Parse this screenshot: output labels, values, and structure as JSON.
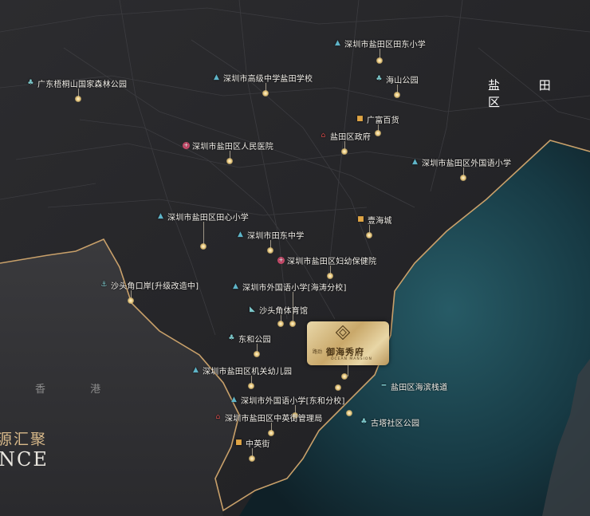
{
  "map": {
    "regions": {
      "yantian": "盐 田 区",
      "hongkong": "香 港"
    },
    "slogan": {
      "cn": "源汇聚",
      "en": "NCE"
    },
    "project": {
      "developer": "路劲",
      "name": "御海秀府",
      "name_en": "OCEAN MANSION"
    },
    "pois": [
      {
        "name": "深圳市盐田区田东小学",
        "icon": "school-icon"
      },
      {
        "name": "广东梧桐山国家森林公园",
        "icon": "park-icon"
      },
      {
        "name": "深圳市高级中学盐田学校",
        "icon": "school-icon"
      },
      {
        "name": "海山公园",
        "icon": "park-icon"
      },
      {
        "name": "广富百货",
        "icon": "shop-icon"
      },
      {
        "name": "盐田区政府",
        "icon": "government-icon"
      },
      {
        "name": "深圳市盐田区人民医院",
        "icon": "hospital-icon"
      },
      {
        "name": "深圳市盐田区外国语小学",
        "icon": "school-icon"
      },
      {
        "name": "深圳市盐田区田心小学",
        "icon": "school-icon"
      },
      {
        "name": "壹海城",
        "icon": "shop-icon"
      },
      {
        "name": "深圳市田东中学",
        "icon": "school-icon"
      },
      {
        "name": "深圳市盐田区妇幼保健院",
        "icon": "hospital-icon"
      },
      {
        "name": "沙头角口岸[升级改造中]",
        "icon": "port-icon"
      },
      {
        "name": "深圳市外国语小学[海涛分校]",
        "icon": "school-icon"
      },
      {
        "name": "沙头角体育馆",
        "icon": "stadium-icon"
      },
      {
        "name": "东和公园",
        "icon": "park-icon"
      },
      {
        "name": "深圳市盐田区机关幼儿园",
        "icon": "school-icon"
      },
      {
        "name": "盐田区海滨栈道",
        "icon": "boardwalk-icon"
      },
      {
        "name": "深圳市外国语小学[东和分校]",
        "icon": "school-icon"
      },
      {
        "name": "深圳市盐田区中英街管理局",
        "icon": "government-icon"
      },
      {
        "name": "古塔社区公园",
        "icon": "park-icon"
      },
      {
        "name": "中英街",
        "icon": "shop-icon"
      }
    ],
    "colors": {
      "land": "#2b2b2e",
      "sea": "#1e4b57",
      "coast": "#c8a06a",
      "accent": "#e8c77a"
    }
  }
}
